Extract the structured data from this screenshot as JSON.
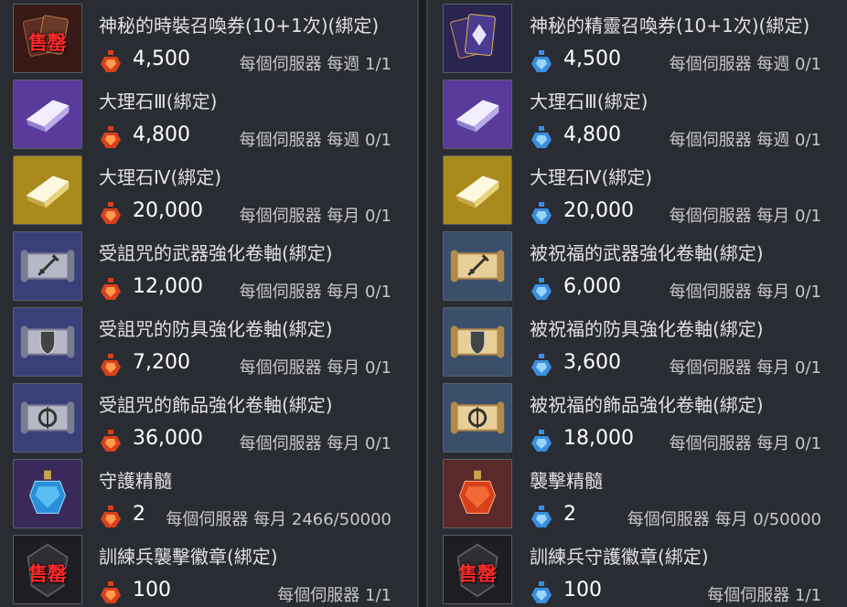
{
  "left_panel": {
    "items": [
      {
        "name": "神秘的時裝召喚券(10+1次)(綁定)",
        "price": "4,500",
        "limit": "每個伺服器 每週 1/1",
        "icon": "costume-summon-ticket-icon",
        "sold_out": "售罄",
        "currency": "red-crystal-icon"
      },
      {
        "name": "大理石Ⅲ(綁定)",
        "price": "4,800",
        "limit": "每個伺服器 每週 0/1",
        "icon": "marble-purple-icon",
        "sold_out": "",
        "currency": "red-crystal-icon"
      },
      {
        "name": "大理石Ⅳ(綁定)",
        "price": "20,000",
        "limit": "每個伺服器 每月 0/1",
        "icon": "marble-gold-icon",
        "sold_out": "",
        "currency": "red-crystal-icon"
      },
      {
        "name": "受詛咒的武器強化卷軸(綁定)",
        "price": "12,000",
        "limit": "每個伺服器 每月 0/1",
        "icon": "cursed-weapon-scroll-icon",
        "sold_out": "",
        "currency": "red-crystal-icon"
      },
      {
        "name": "受詛咒的防具強化卷軸(綁定)",
        "price": "7,200",
        "limit": "每個伺服器 每月 0/1",
        "icon": "cursed-armor-scroll-icon",
        "sold_out": "",
        "currency": "red-crystal-icon"
      },
      {
        "name": "受詛咒的飾品強化卷軸(綁定)",
        "price": "36,000",
        "limit": "每個伺服器 每月 0/1",
        "icon": "cursed-accessory-scroll-icon",
        "sold_out": "",
        "currency": "red-crystal-icon"
      },
      {
        "name": "守護精髓",
        "price": "2",
        "limit": "每個伺服器 每月 2466/50000",
        "icon": "guardian-essence-icon",
        "sold_out": "",
        "currency": "red-crystal-icon"
      },
      {
        "name": "訓練兵襲擊徽章(綁定)",
        "price": "100",
        "limit": "每個伺服器 1/1",
        "icon": "trainee-assault-badge-icon",
        "sold_out": "售罄",
        "currency": "red-crystal-icon"
      }
    ]
  },
  "right_panel": {
    "items": [
      {
        "name": "神秘的精靈召喚券(10+1次)(綁定)",
        "price": "4,500",
        "limit": "每個伺服器 每週 0/1",
        "icon": "spirit-summon-ticket-icon",
        "sold_out": "",
        "currency": "blue-crystal-icon"
      },
      {
        "name": "大理石Ⅲ(綁定)",
        "price": "4,800",
        "limit": "每個伺服器 每週 0/1",
        "icon": "marble-purple-icon",
        "sold_out": "",
        "currency": "blue-crystal-icon"
      },
      {
        "name": "大理石Ⅳ(綁定)",
        "price": "20,000",
        "limit": "每個伺服器 每月 0/1",
        "icon": "marble-gold-icon",
        "sold_out": "",
        "currency": "blue-crystal-icon"
      },
      {
        "name": "被祝福的武器強化卷軸(綁定)",
        "price": "6,000",
        "limit": "每個伺服器 每月 0/1",
        "icon": "blessed-weapon-scroll-icon",
        "sold_out": "",
        "currency": "blue-crystal-icon"
      },
      {
        "name": "被祝福的防具強化卷軸(綁定)",
        "price": "3,600",
        "limit": "每個伺服器 每月 0/1",
        "icon": "blessed-armor-scroll-icon",
        "sold_out": "",
        "currency": "blue-crystal-icon"
      },
      {
        "name": "被祝福的飾品強化卷軸(綁定)",
        "price": "18,000",
        "limit": "每個伺服器 每月 0/1",
        "icon": "blessed-accessory-scroll-icon",
        "sold_out": "",
        "currency": "blue-crystal-icon"
      },
      {
        "name": "襲擊精髓",
        "price": "2",
        "limit": "每個伺服器 每月 0/50000",
        "icon": "assault-essence-icon",
        "sold_out": "",
        "currency": "blue-crystal-icon"
      },
      {
        "name": "訓練兵守護徽章(綁定)",
        "price": "100",
        "limit": "每個伺服器 1/1",
        "icon": "trainee-guardian-badge-icon",
        "sold_out": "售罄",
        "currency": "blue-crystal-icon"
      }
    ]
  },
  "colors": {
    "panel_bg": "#2a2c33",
    "sold_out_text": "#ff2a2a",
    "red_currency": "#d8401c",
    "blue_currency": "#3a8ee0",
    "marble_purple_bg": "#5a3a9a",
    "marble_gold_bg": "#a88a1c",
    "cursed_scroll_bg": "#3b3f78",
    "blessed_scroll_bg": "#3b4f6a"
  }
}
